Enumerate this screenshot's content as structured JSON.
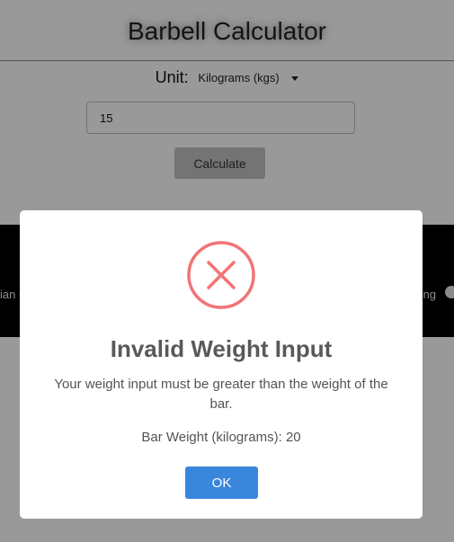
{
  "app": {
    "title": "Barbell Calculator"
  },
  "unit": {
    "label": "Unit:",
    "selected": "Kilograms (kgs)"
  },
  "weight_input": {
    "value": "15"
  },
  "calculate_button": {
    "label": "Calculate"
  },
  "footer": {
    "left_fragment": "ian (",
    "right_fragment": "ong"
  },
  "modal": {
    "icon": "error-x-circle-icon",
    "icon_color": "#f27474",
    "title": "Invalid Weight Input",
    "message": "Your weight input must be greater than the weight of the bar.",
    "detail": "Bar Weight (kilograms): 20",
    "ok_label": "OK",
    "ok_color": "#3a86dc"
  }
}
